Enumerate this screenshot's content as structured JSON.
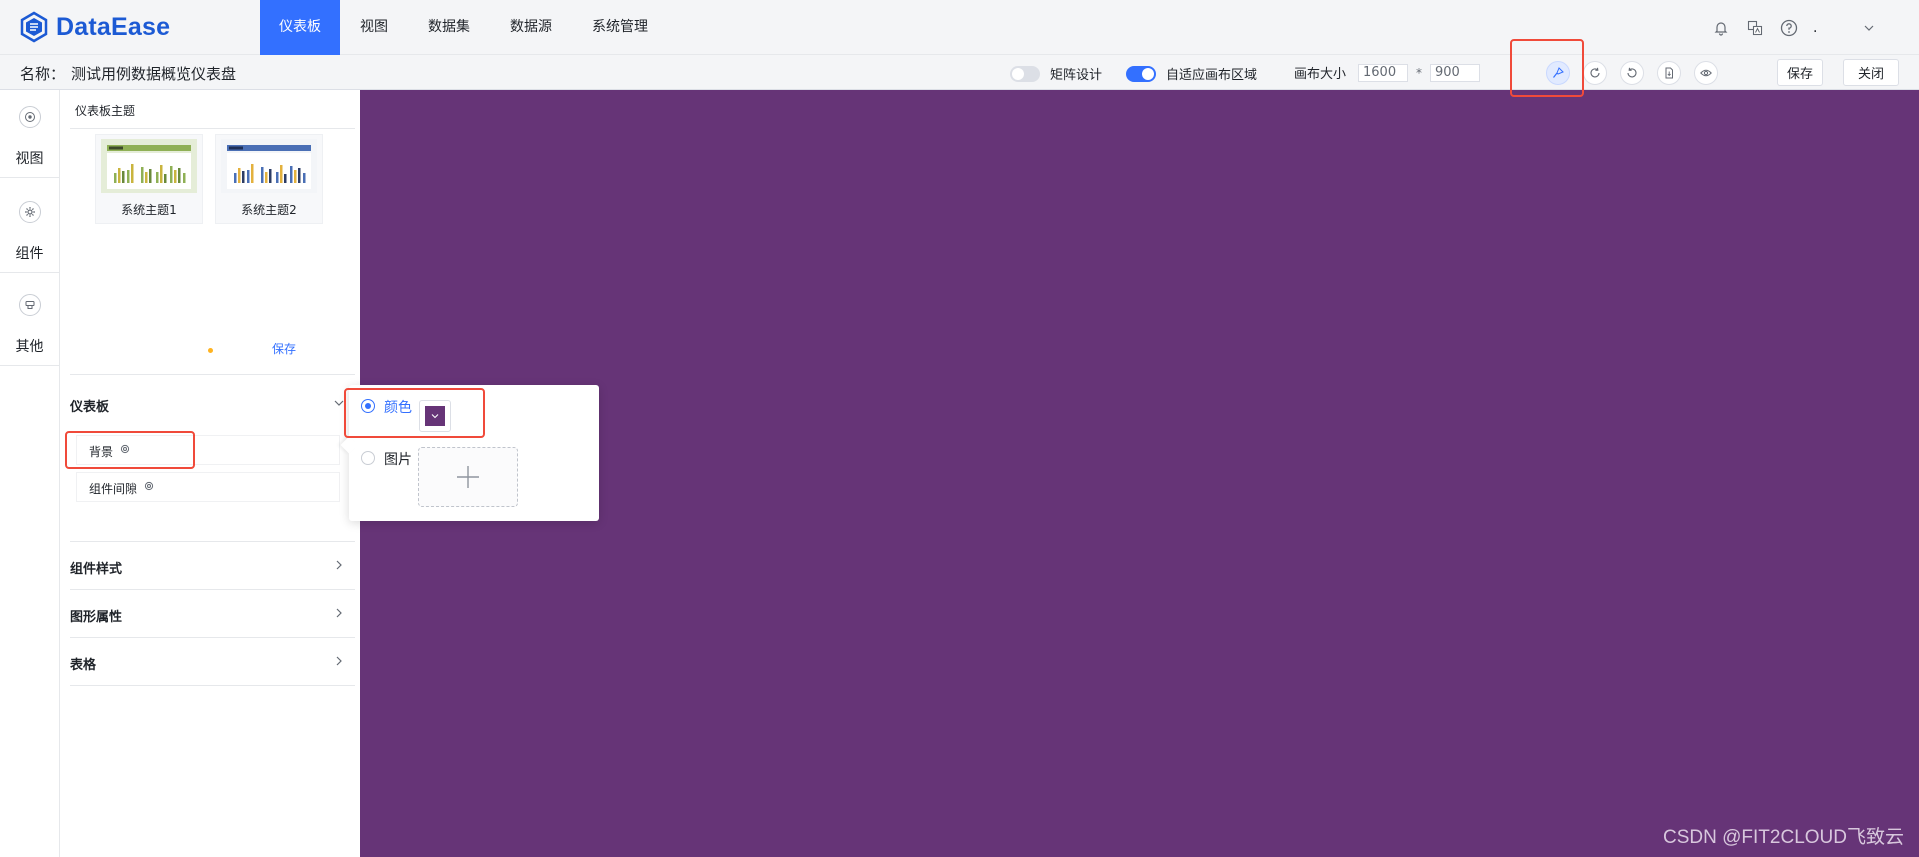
{
  "app": {
    "logo_text": "DataEase"
  },
  "nav": {
    "items": [
      {
        "label": "仪表板",
        "active": true
      },
      {
        "label": "视图",
        "active": false
      },
      {
        "label": "数据集",
        "active": false
      },
      {
        "label": "数据源",
        "active": false
      },
      {
        "label": "系统管理",
        "active": false
      }
    ]
  },
  "topright": {
    "icons": [
      "bell-icon",
      "translate-icon",
      "help-icon"
    ],
    "user": "."
  },
  "toolbar": {
    "name_label": "名称：",
    "name_value": "测试用例数据概览仪表盘",
    "matrix_design": {
      "label": "矩阵设计",
      "on": false
    },
    "auto_fit": {
      "label": "自适应画布区域",
      "on": true
    },
    "canvas_size_label": "画布大小",
    "canvas_width": "1600",
    "canvas_height": "900",
    "size_separator": "*",
    "icons": [
      "style-brush-icon",
      "refresh-icon",
      "undo-icon",
      "export-icon",
      "preview-icon"
    ],
    "save_label": "保存",
    "close_label": "关闭"
  },
  "rail": {
    "items": [
      {
        "label": "视图",
        "icon": "target-icon"
      },
      {
        "label": "组件",
        "icon": "gear-icon"
      },
      {
        "label": "其他",
        "icon": "component-icon"
      }
    ]
  },
  "panel": {
    "theme_title": "仪表板主题",
    "themes": [
      {
        "name": "系统主题1",
        "accent": "#8fb055"
      },
      {
        "name": "系统主题2",
        "accent": "#4a6fb5"
      }
    ],
    "save_label": "保存",
    "sections": {
      "dashboard": "仪表板",
      "background": "背景",
      "component_gap": "组件间隙",
      "component_style": "组件样式",
      "graphic_props": "图形属性",
      "table": "表格"
    }
  },
  "popover": {
    "color_label": "颜色",
    "image_label": "图片",
    "color_selected": true,
    "color_value": "#663477"
  },
  "canvas": {
    "background": "#663477"
  },
  "watermark": "CSDN @FIT2CLOUD飞致云"
}
